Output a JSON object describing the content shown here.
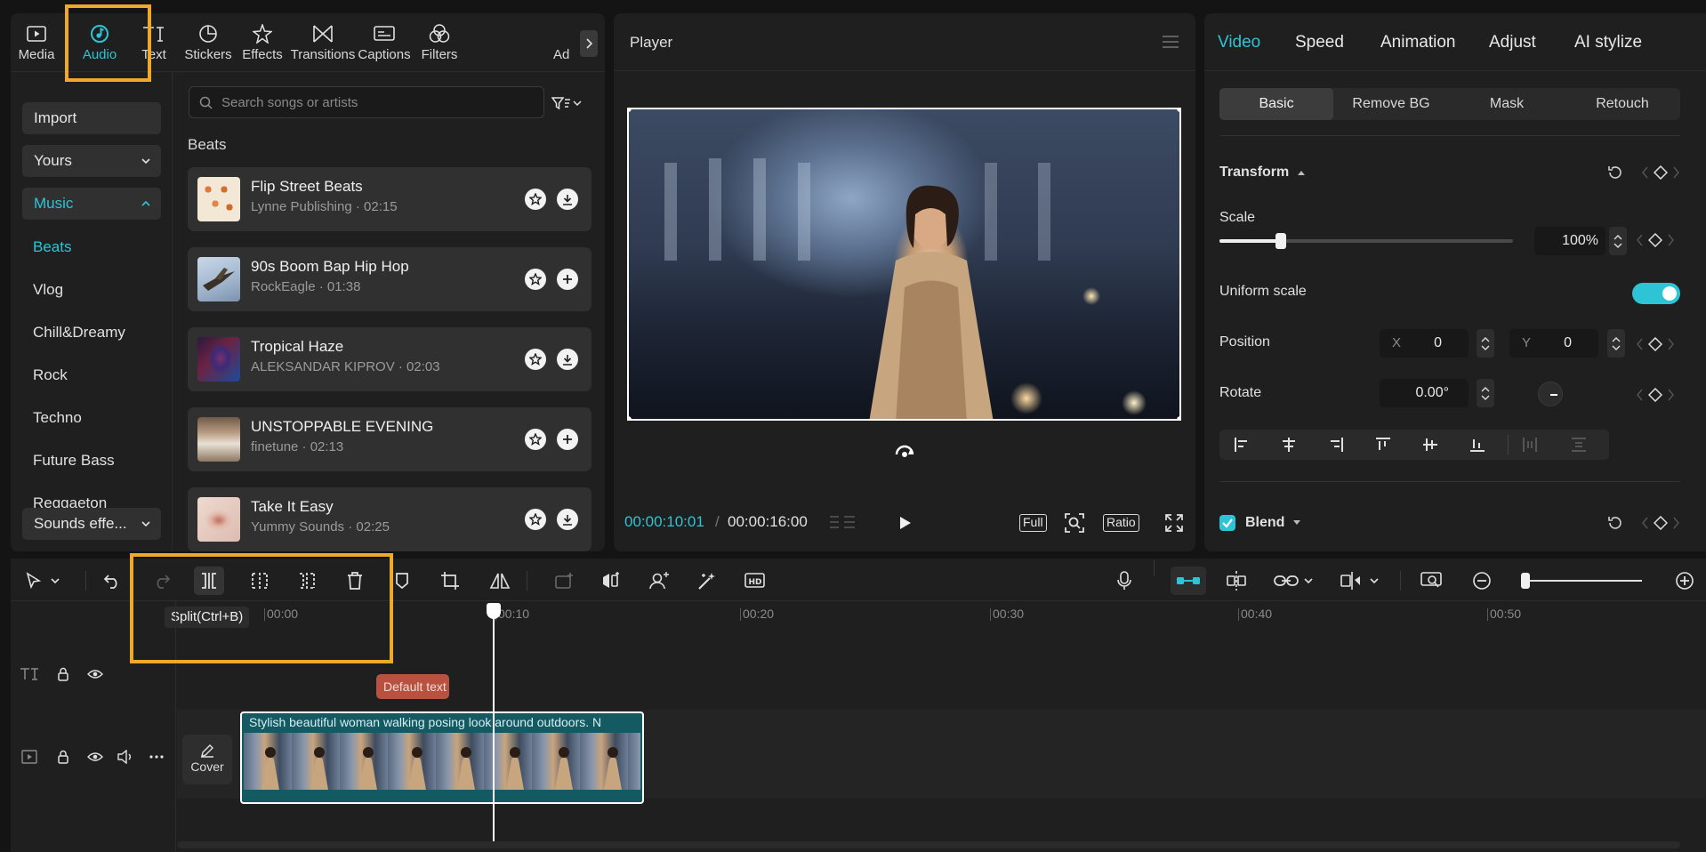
{
  "toolbar_tabs": [
    {
      "label": "Media",
      "icon": "media-icon"
    },
    {
      "label": "Audio",
      "icon": "audio-icon"
    },
    {
      "label": "Text",
      "icon": "text-icon"
    },
    {
      "label": "Stickers",
      "icon": "stickers-icon"
    },
    {
      "label": "Effects",
      "icon": "effects-icon"
    },
    {
      "label": "Transitions",
      "icon": "transitions-icon"
    },
    {
      "label": "Captions",
      "icon": "captions-icon"
    },
    {
      "label": "Filters",
      "icon": "filters-icon"
    },
    {
      "label": "Ad",
      "icon": "adjust-icon"
    }
  ],
  "sidebar": {
    "import_label": "Import",
    "yours_label": "Yours",
    "music_label": "Music",
    "items": [
      "Beats",
      "Vlog",
      "Chill&Dreamy",
      "Rock",
      "Techno",
      "Future Bass",
      "Reggaeton"
    ],
    "sounds_label": "Sounds effe..."
  },
  "search": {
    "placeholder": "Search songs or artists"
  },
  "section_title": "Beats",
  "songs": [
    {
      "title": "Flip Street Beats",
      "subtitle": "Lynne Publishing · 02:15",
      "action": "download-icon"
    },
    {
      "title": "90s Boom Bap Hip Hop",
      "subtitle": "RockEagle · 01:38",
      "action": "add-icon"
    },
    {
      "title": "Tropical Haze",
      "subtitle": "ALEKSANDAR KIPROV · 02:03",
      "action": "download-icon"
    },
    {
      "title": "UNSTOPPABLE EVENING",
      "subtitle": "finetune · 02:13",
      "action": "add-icon"
    },
    {
      "title": "Take It Easy",
      "subtitle": "Yummy Sounds · 02:25",
      "action": "download-icon"
    }
  ],
  "player": {
    "title": "Player",
    "current_time": "00:00:10:01",
    "separator": "/",
    "total_time": "00:00:16:00",
    "full_label": "Full",
    "ratio_label": "Ratio"
  },
  "right_tabs": [
    "Video",
    "Speed",
    "Animation",
    "Adjust",
    "AI stylize"
  ],
  "sub_tabs": [
    "Basic",
    "Remove BG",
    "Mask",
    "Retouch"
  ],
  "properties": {
    "transform_label": "Transform",
    "scale_label": "Scale",
    "scale_value": "100%",
    "scale_fraction": 0.21,
    "uniform_scale_label": "Uniform scale",
    "uniform_scale_on": true,
    "position_label": "Position",
    "x_label": "X",
    "x_value": "0",
    "y_label": "Y",
    "y_value": "0",
    "rotate_label": "Rotate",
    "rotate_value": "0.00°",
    "blend_label": "Blend"
  },
  "timeline": {
    "tooltip": "Split(Ctrl+B)",
    "ruler_ticks": [
      "00:00",
      "00:10",
      "00:20",
      "00:30",
      "00:40",
      "00:50"
    ],
    "text_clip_label": "Default text",
    "video_clip_label": "Stylish beautiful woman walking posing look around outdoors. N",
    "cover_label": "Cover",
    "zoom_fraction": 0.0
  },
  "colors": {
    "accent": "#2dc5d5",
    "highlight": "#f0a82a",
    "text_clip": "#b8513f",
    "video_clip": "#135a63"
  }
}
